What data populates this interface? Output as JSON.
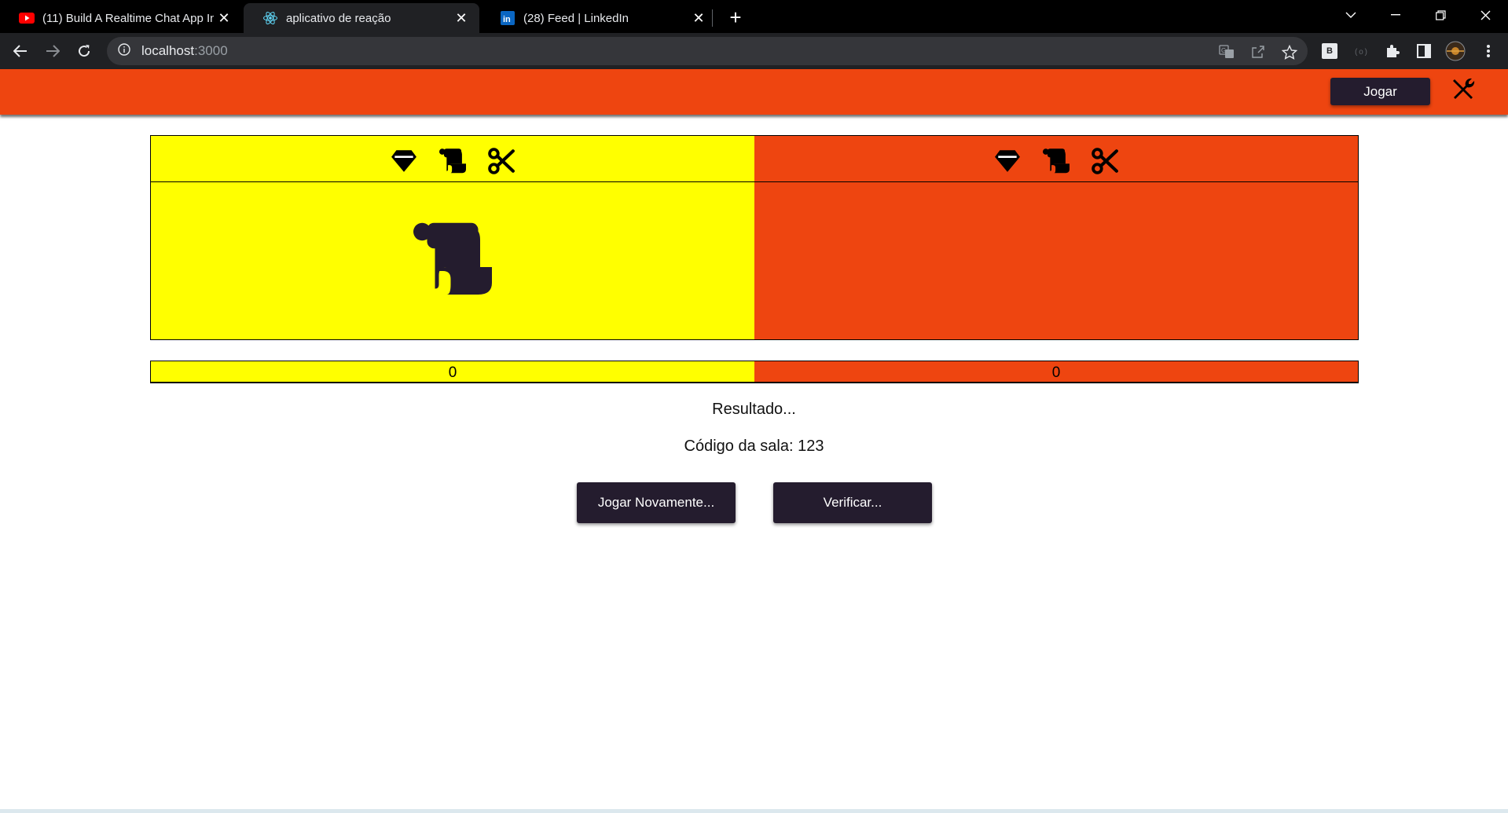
{
  "browser": {
    "tabs": [
      {
        "title": "(11) Build A Realtime Chat App In",
        "favicon": "youtube-icon",
        "active": false
      },
      {
        "title": "aplicativo de reação",
        "favicon": "react-icon",
        "active": true
      },
      {
        "title": "(28) Feed | LinkedIn",
        "favicon": "linkedin-icon",
        "active": false
      }
    ],
    "new_tab_label": "+",
    "url_host": "localhost",
    "url_port": ":3000",
    "profile_ext_label": "B"
  },
  "app": {
    "header": {
      "play_label": "Jogar",
      "tools_icon": "tools-icon"
    },
    "colors": {
      "player1": "#ffff00",
      "player2": "#ee4510",
      "button": "#241c2e"
    },
    "players": [
      {
        "choices": [
          "gem-icon",
          "scroll-icon",
          "scissors-icon"
        ],
        "picked": "scroll-icon",
        "score": "0"
      },
      {
        "choices": [
          "gem-icon",
          "scroll-icon",
          "scissors-icon"
        ],
        "picked": "",
        "score": "0"
      }
    ],
    "result_text": "Resultado...",
    "room_text": "Código da sala: 123",
    "buttons": {
      "play_again": "Jogar Novamente...",
      "verify": "Verificar..."
    }
  }
}
